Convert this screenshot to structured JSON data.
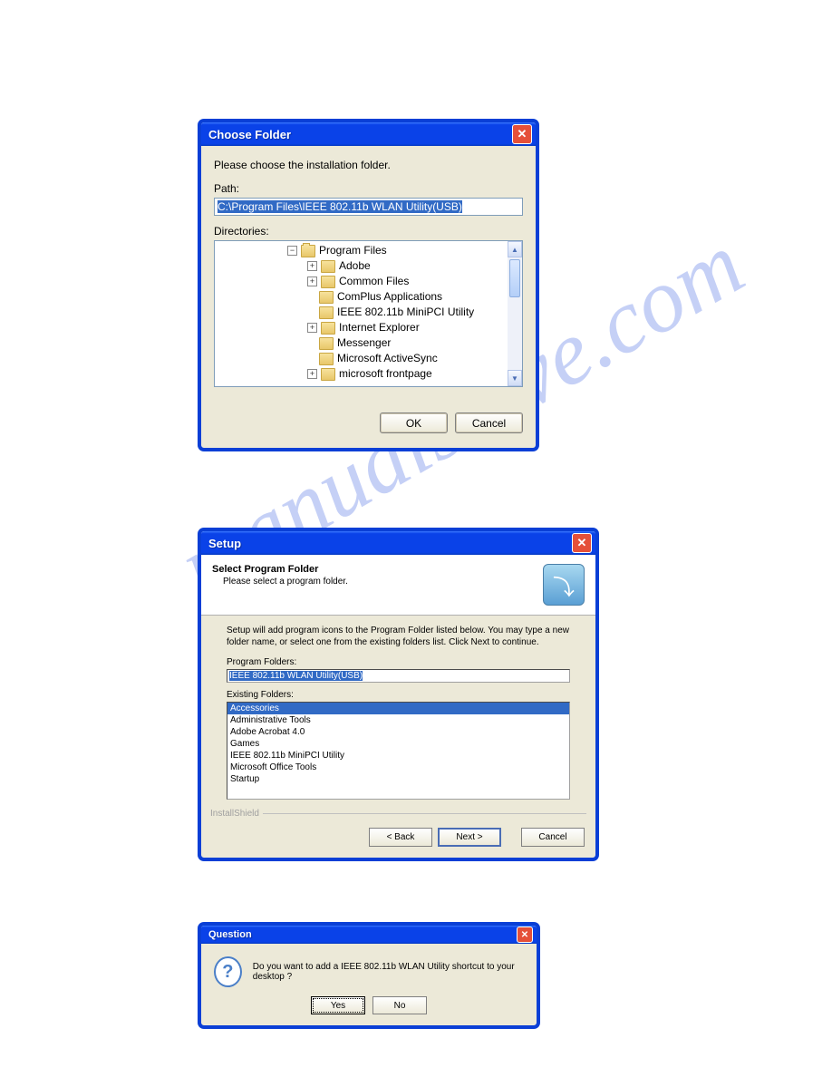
{
  "watermark": "manualshive.com",
  "dialog1": {
    "title": "Choose Folder",
    "instruction": "Please choose the installation folder.",
    "path_label": "Path:",
    "path_value": "C:\\Program Files\\IEEE 802.11b WLAN Utility(USB)",
    "directories_label": "Directories:",
    "tree": {
      "root": "Program Files",
      "children": [
        {
          "name": "Adobe",
          "exp": "+"
        },
        {
          "name": "Common Files",
          "exp": "+"
        },
        {
          "name": "ComPlus Applications",
          "exp": ""
        },
        {
          "name": "IEEE 802.11b MiniPCI Utility",
          "exp": ""
        },
        {
          "name": "Internet Explorer",
          "exp": "+"
        },
        {
          "name": "Messenger",
          "exp": ""
        },
        {
          "name": "Microsoft ActiveSync",
          "exp": ""
        },
        {
          "name": "microsoft frontpage",
          "exp": "+"
        }
      ]
    },
    "ok": "OK",
    "cancel": "Cancel"
  },
  "dialog2": {
    "title": "Setup",
    "heading": "Select Program Folder",
    "subheading": "Please select a program folder.",
    "description": "Setup will add program icons to the Program Folder listed below.  You may type a new folder name, or select one from the existing folders list.  Click Next to continue.",
    "program_folders_label": "Program Folders:",
    "program_folder_value": "IEEE 802.11b WLAN Utility(USB)",
    "existing_folders_label": "Existing Folders:",
    "existing_folders": [
      "Accessories",
      "Administrative Tools",
      "Adobe Acrobat 4.0",
      "Games",
      "IEEE 802.11b MiniPCI Utility",
      "Microsoft Office Tools",
      "Startup"
    ],
    "brand": "InstallShield",
    "back": "< Back",
    "next": "Next >",
    "cancel": "Cancel"
  },
  "dialog3": {
    "title": "Question",
    "message": "Do you want to add a IEEE 802.11b WLAN Utility shortcut to your desktop ?",
    "yes": "Yes",
    "no": "No"
  }
}
